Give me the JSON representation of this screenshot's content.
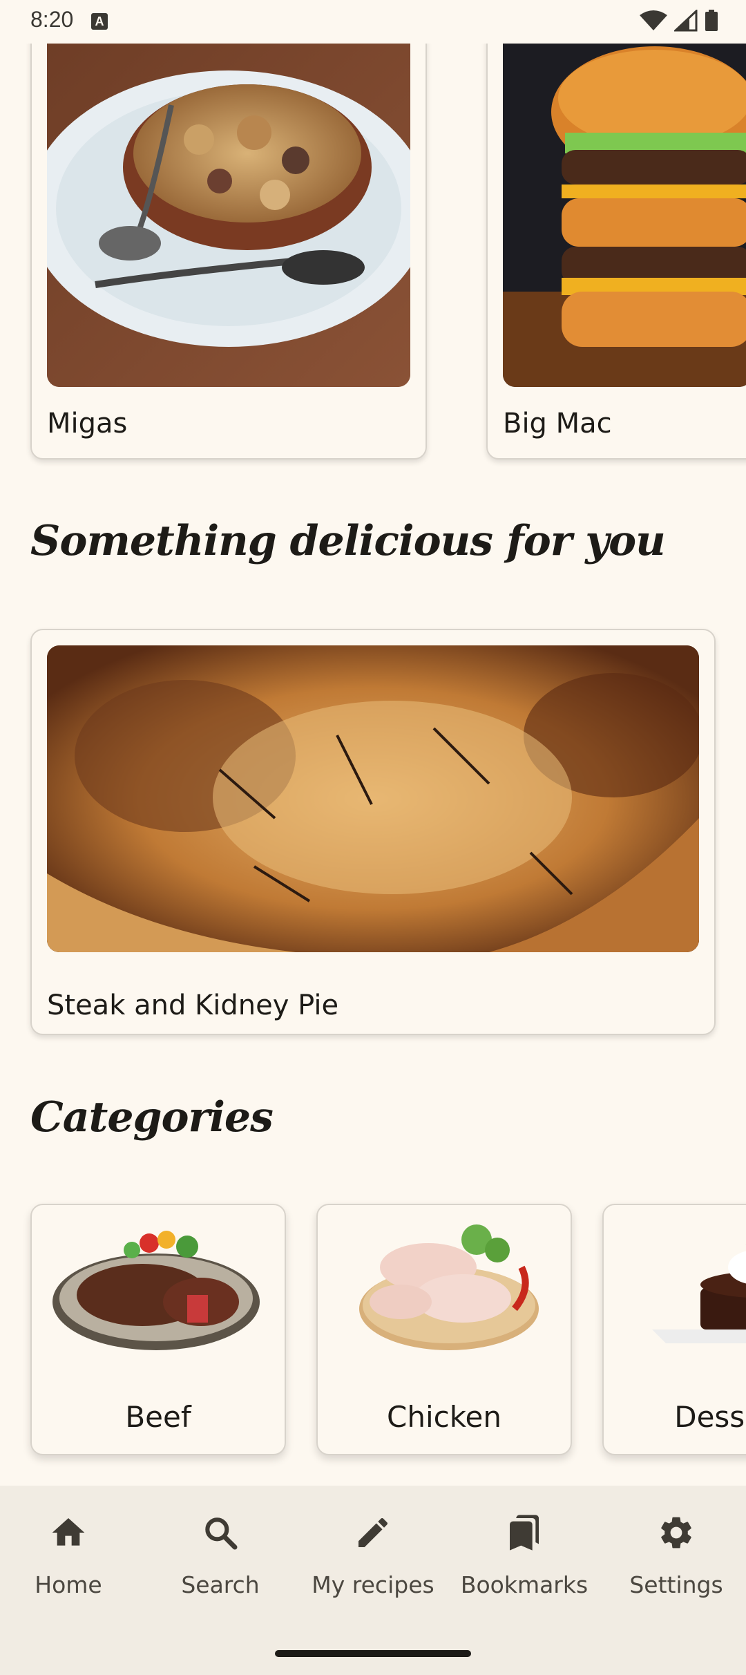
{
  "status_bar": {
    "time": "8:20",
    "notification_icon": "A"
  },
  "top_row": [
    {
      "title": "Migas"
    },
    {
      "title": "Big Mac"
    }
  ],
  "featured": {
    "section_title": "Something delicious for you",
    "title": "Steak and Kidney Pie"
  },
  "categories": {
    "section_title": "Categories",
    "items": [
      {
        "label": "Beef"
      },
      {
        "label": "Chicken"
      },
      {
        "label": "Dessert"
      }
    ]
  },
  "bottom_nav": [
    {
      "label": "Home",
      "icon": "home-icon"
    },
    {
      "label": "Search",
      "icon": "search-icon"
    },
    {
      "label": "My recipes",
      "icon": "pencil-icon"
    },
    {
      "label": "Bookmarks",
      "icon": "bookmarks-icon"
    },
    {
      "label": "Settings",
      "icon": "gear-icon"
    }
  ]
}
